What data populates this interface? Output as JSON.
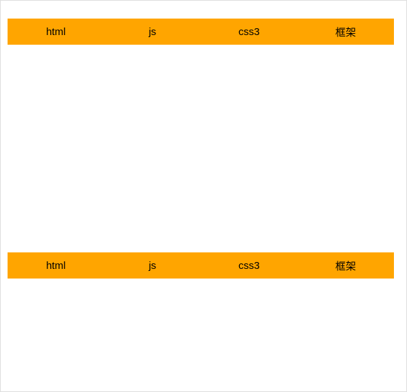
{
  "navTop": {
    "items": [
      {
        "label": "html"
      },
      {
        "label": "js"
      },
      {
        "label": "css3"
      },
      {
        "label": "框架"
      }
    ]
  },
  "navBottom": {
    "items": [
      {
        "label": "html"
      },
      {
        "label": "js"
      },
      {
        "label": "css3"
      },
      {
        "label": "框架"
      }
    ]
  }
}
